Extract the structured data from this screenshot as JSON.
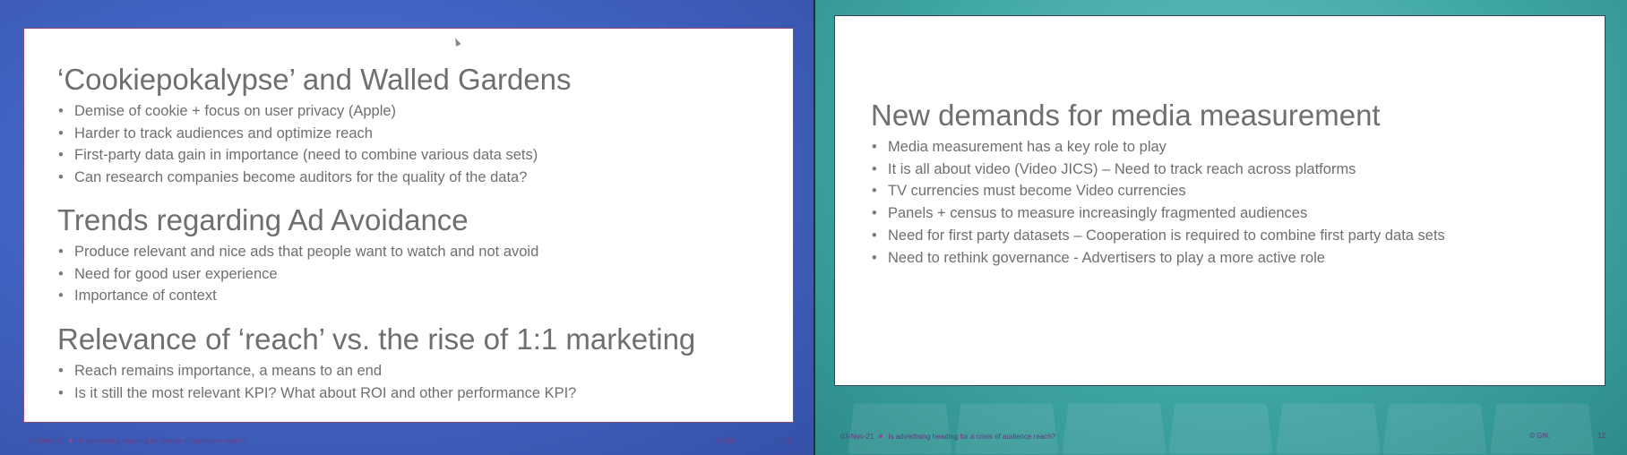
{
  "left_slide": {
    "sections": [
      {
        "heading": "‘Cookiepokalypse’ and Walled Gardens",
        "bullets": [
          "Demise of cookie + focus on user privacy (Apple)",
          "Harder to track audiences and optimize reach",
          "First-party data gain in importance (need to combine various data sets)",
          "Can research companies become auditors for the quality of the data?"
        ]
      },
      {
        "heading": "Trends regarding Ad Avoidance",
        "bullets": [
          "Produce relevant and nice ads that people want to watch and not avoid",
          "Need for good user experience",
          "Importance of context"
        ]
      },
      {
        "heading": "Relevance of ‘reach’ vs. the rise of 1:1 marketing",
        "bullets": [
          "Reach remains importance, a means to an end",
          "Is it still the most relevant KPI?  What about ROI and other performance KPI?"
        ]
      }
    ],
    "footer": {
      "date": "03-Nov-21",
      "title": "Is advertising heading for a crisis of audience reach?",
      "copyright": "© GfK",
      "page_number": "10"
    }
  },
  "right_slide": {
    "heading": "New demands for media measurement",
    "bullets": [
      "Media measurement has a key role to play",
      "It is all about video (Video JICS) – Need to track reach across platforms",
      "TV currencies must become Video currencies",
      "Panels + census to measure increasingly fragmented audiences",
      "Need for first party datasets – Cooperation is required to combine first party data sets",
      "Need to rethink governance - Advertisers to play a more active role"
    ],
    "footer": {
      "date": "03-Nov-21",
      "title": "Is advertising heading for a crisis of audience reach?",
      "copyright": "© GfK",
      "page_number": "12"
    }
  },
  "colors": {
    "left_background": "#4264c3",
    "right_background": "#3fa6a4",
    "text": "#6f6f6f",
    "footer_text": "#6b3d86"
  }
}
